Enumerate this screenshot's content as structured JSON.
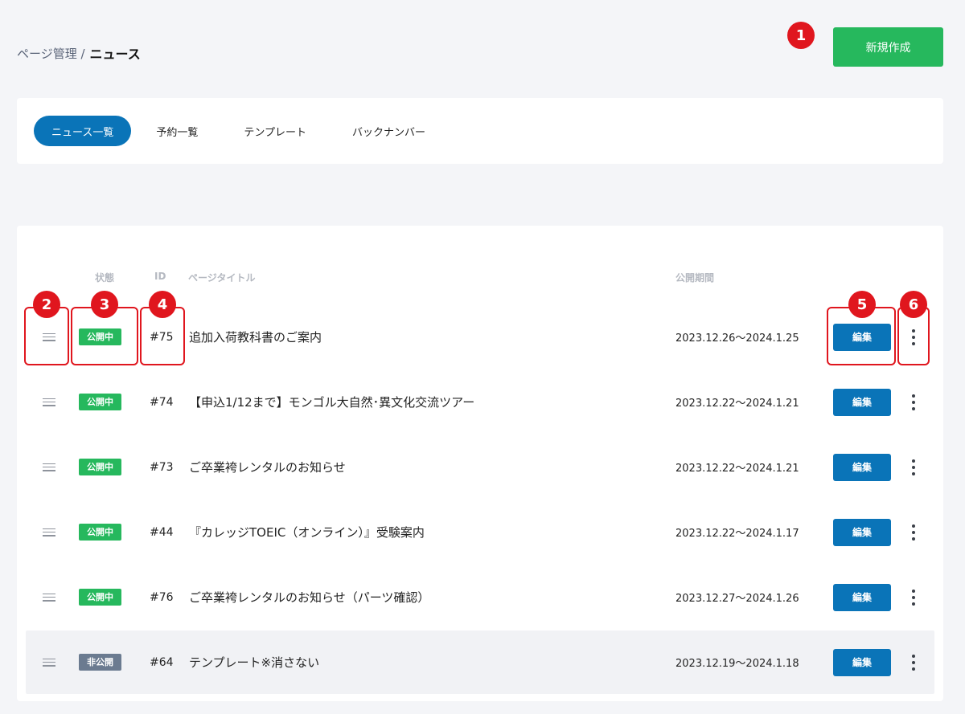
{
  "breadcrumb": {
    "parent": "ページ管理 /",
    "current": "ニュース"
  },
  "new_button": "新規作成",
  "tabs": [
    {
      "label": "ニュース一覧",
      "active": true
    },
    {
      "label": "予約一覧",
      "active": false
    },
    {
      "label": "テンプレート",
      "active": false
    },
    {
      "label": "バックナンバー",
      "active": false
    }
  ],
  "table": {
    "headers": {
      "status": "状態",
      "id": "ID",
      "title": "ページタイトル",
      "period": "公開期間"
    },
    "edit_label": "編集",
    "rows": [
      {
        "status": "公開中",
        "status_type": "public",
        "id": "#75",
        "title": "追加入荷教科書のご案内",
        "period": "2023.12.26〜2024.1.25"
      },
      {
        "status": "公開中",
        "status_type": "public",
        "id": "#74",
        "title": "【申込1/12まで】モンゴル大自然･異文化交流ツアー",
        "period": "2023.12.22〜2024.1.21"
      },
      {
        "status": "公開中",
        "status_type": "public",
        "id": "#73",
        "title": "ご卒業袴レンタルのお知らせ",
        "period": "2023.12.22〜2024.1.21"
      },
      {
        "status": "公開中",
        "status_type": "public",
        "id": "#44",
        "title": "『カレッジTOEIC（オンライン）』受験案内",
        "period": "2023.12.22〜2024.1.17"
      },
      {
        "status": "公開中",
        "status_type": "public",
        "id": "#76",
        "title": "ご卒業袴レンタルのお知らせ（パーツ確認）",
        "period": "2023.12.27〜2024.1.26"
      },
      {
        "status": "非公開",
        "status_type": "private",
        "id": "#64",
        "title": "テンプレート※消さない",
        "period": "2023.12.19〜2024.1.18"
      }
    ]
  },
  "annotations": [
    "1",
    "2",
    "3",
    "4",
    "5",
    "6"
  ],
  "colors": {
    "accent_blue": "#0a74b8",
    "accent_green": "#26b85d",
    "private_gray": "#6b7b90",
    "annotation_red": "#e0161e"
  }
}
